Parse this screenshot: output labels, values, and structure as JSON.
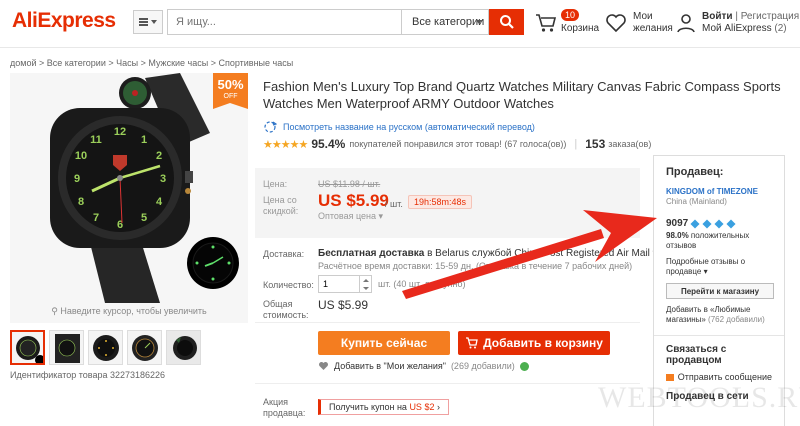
{
  "header": {
    "logo": "AliExpress",
    "search_placeholder": "Я ищу...",
    "search_category": "Все категории",
    "cart_count": "10",
    "cart_label": "Корзина",
    "wish_line1": "Мои",
    "wish_line2": "желания",
    "login": "Войти",
    "register": "Регистрация",
    "my_account": "Мой AliExpress",
    "my_account_count": "(2)"
  },
  "breadcrumb": "домой > Все категории > Часы > Мужские часы > Спортивные часы",
  "gallery": {
    "discount_percent": "50%",
    "discount_off": "OFF",
    "zoom_hint": "Наведите курсор, чтобы увеличить",
    "product_id": "Идентификатор товара 32273186226"
  },
  "product": {
    "title": "Fashion Men's Luxury Top Brand Quartz Watches Military Canvas Fabric Compass Sports Watches Men Waterproof ARMY Outdoor Watches",
    "translate_link": "Посмотреть название на русском (автоматический перевод)",
    "stars": "★★★★★",
    "rating_percent": "95.4%",
    "rating_text": "покупателей понравился этот товар! (67 голоса(ов))",
    "orders_count": "153",
    "orders_label": "заказа(ов)"
  },
  "price": {
    "price_label": "Цена:",
    "old_price": "US $11.98 / шт.",
    "discount_label_1": "Цена со",
    "discount_label_2": "скидкой:",
    "new_price": "US $5.99",
    "unit": "/ шт.",
    "timer": "19h:58m:48s",
    "wholesale": "Оптовая цена ▾"
  },
  "shipping": {
    "label": "Доставка:",
    "main_bold": "Бесплатная доставка",
    "main_rest": "в Belarus службой China Post Registered Air Mail ▾",
    "sub": "Расчётное время доставки: 15-59 дн. (Отправка в течение 7 рабочих дней)"
  },
  "quantity": {
    "label": "Количество:",
    "value": "1",
    "note": "шт. (40 шт. доступно)"
  },
  "total": {
    "label_1": "Общая",
    "label_2": "стоимость:",
    "value": "US $5.99"
  },
  "actions": {
    "buy_now": "Купить сейчас",
    "add_to_cart": "Добавить в корзину",
    "wishlist": "Добавить в \"Мои желания\"",
    "wishlist_count": "(269 добавили)"
  },
  "promo": {
    "label_1": "Акция",
    "label_2": "продавца:",
    "coupon_text": "Получить купон на",
    "coupon_value": "US $2",
    "coupon_arrow": "›"
  },
  "seller": {
    "heading": "Продавец:",
    "name": "KINGDOM of TIMEZONE",
    "country": "China (Mainland)",
    "score": "9097",
    "positive_pct": "98.0%",
    "positive_text": "положительных отзывов",
    "details_link": "Подробные отзывы о продавце ▾",
    "store_button": "Перейти к магазину",
    "fav_text": "Добавить в «Любимые магазины»",
    "fav_count": "(762 добавили)",
    "contact_heading": "Связаться с продавцом",
    "send_message": "Отправить сообщение",
    "online_heading": "Продавец в сети"
  },
  "watermark": "WEBTOOLS.RU",
  "colors": {
    "brand_red": "#e62e04",
    "orange": "#f47d20",
    "link_blue": "#2b72c7",
    "annotation_arrow": "#e8291c"
  }
}
